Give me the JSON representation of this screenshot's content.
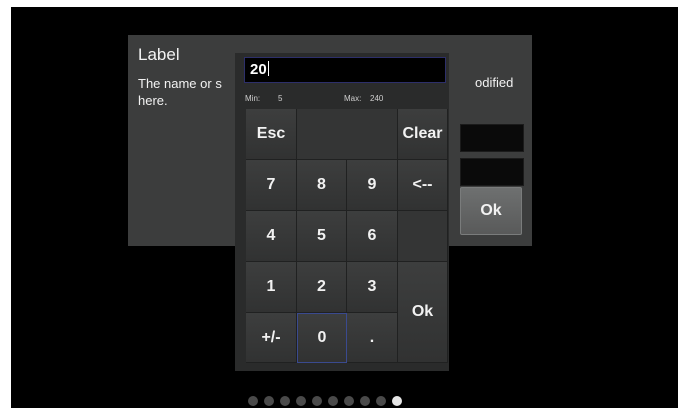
{
  "dialog": {
    "title": "Label",
    "description_left": "The name or s",
    "description_right": "odified",
    "description_line2": "here.",
    "ok_label": "Ok"
  },
  "keypad": {
    "value": "20",
    "min_label": "Min:",
    "min_value": "5",
    "max_label": "Max:",
    "max_value": "240",
    "keys": {
      "esc": "Esc",
      "clear": "Clear",
      "k7": "7",
      "k8": "8",
      "k9": "9",
      "back": "<--",
      "k4": "4",
      "k5": "5",
      "k6": "6",
      "k1": "1",
      "k2": "2",
      "k3": "3",
      "ok": "Ok",
      "sign": "+/-",
      "k0": "0",
      "dot": "."
    }
  },
  "pager": {
    "count": 10,
    "active_index": 9
  },
  "colors": {
    "background": "#000000",
    "dialog": "#3c3d3d",
    "keypad": "#2a2b2b"
  }
}
